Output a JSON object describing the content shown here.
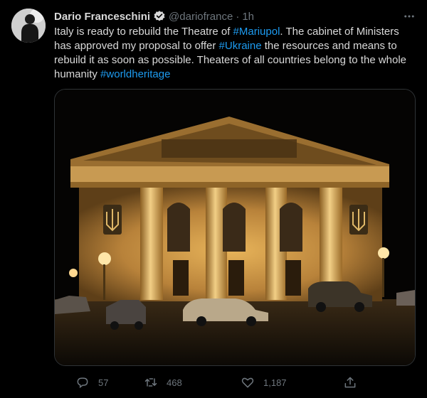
{
  "tweet": {
    "author": {
      "display_name": "Dario Franceschini",
      "handle": "@dariofrance",
      "separator": "·",
      "time": "1h",
      "verified": true
    },
    "text": {
      "part1": "Italy is ready to rebuild the Theatre of ",
      "hashtag1": "#Mariupol",
      "part2": ". The cabinet of Ministers has approved my proposal to offer ",
      "hashtag2": "#Ukraine",
      "part3": " the resources and means to rebuild it as soon as possible. Theaters of all countries belong to the whole humanity ",
      "hashtag3": "#worldheritage"
    },
    "actions": {
      "reply_count": "57",
      "retweet_count": "468",
      "like_count": "1,187"
    }
  },
  "colors": {
    "background": "#000000",
    "text": "#d9d9d9",
    "muted": "#6e767d",
    "link": "#1d9bf0",
    "verified_badge": "#d9d9d9"
  }
}
